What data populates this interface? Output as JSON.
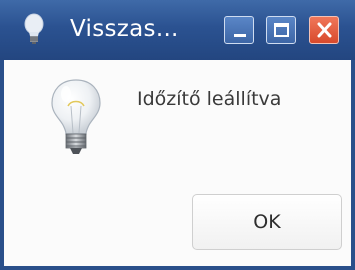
{
  "window": {
    "title": "Visszas...",
    "controls": {
      "minimize_icon": "minimize-icon",
      "maximize_icon": "maximize-icon",
      "close_icon": "close-icon"
    }
  },
  "dialog": {
    "icon": "lightbulb-icon",
    "message": "Időzítő leállítva",
    "ok_label": "OK"
  },
  "colors": {
    "titlebar": "#2b5291",
    "close_button": "#e05a3c",
    "background": "#fbfbfb"
  }
}
